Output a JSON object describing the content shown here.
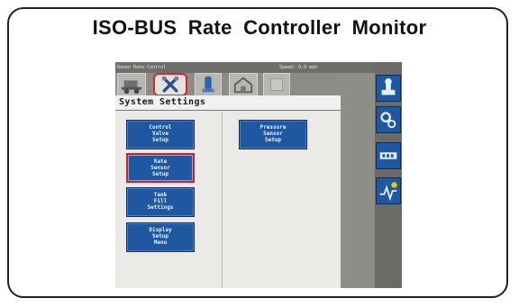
{
  "caption": "ISO-BUS Rate Controller Monitor",
  "topbar": {
    "left_text": "Raven Rate Control",
    "right_text": "Speed: 0.0 mph"
  },
  "tabs": [
    {
      "icon": "sprayer-icon",
      "selected": false
    },
    {
      "icon": "tools-icon",
      "selected": true
    },
    {
      "icon": "tank-icon",
      "selected": false
    },
    {
      "icon": "home-icon",
      "selected": false
    },
    {
      "icon": "blank-icon",
      "selected": false
    }
  ],
  "screen_title": "System Settings",
  "buttons": {
    "control_valve": "Control\nValve\nSetup",
    "rate_sensor": "Rate\nSensor\nSetup",
    "tank_fill": "Tank\nFill\nSettings",
    "display_setup": "Display\nSetup\nMenu",
    "pressure_sensor": "Pressure\nSensor\nSetup"
  },
  "selected_button": "rate_sensor",
  "side_buttons": [
    "implement-icon",
    "gears-icon",
    "meter-icon",
    "graph-alert-icon"
  ],
  "colors": {
    "button_blue": "#1f57a1",
    "highlight_red": "#d4262b",
    "bezel_gray": "#8e8c87"
  }
}
